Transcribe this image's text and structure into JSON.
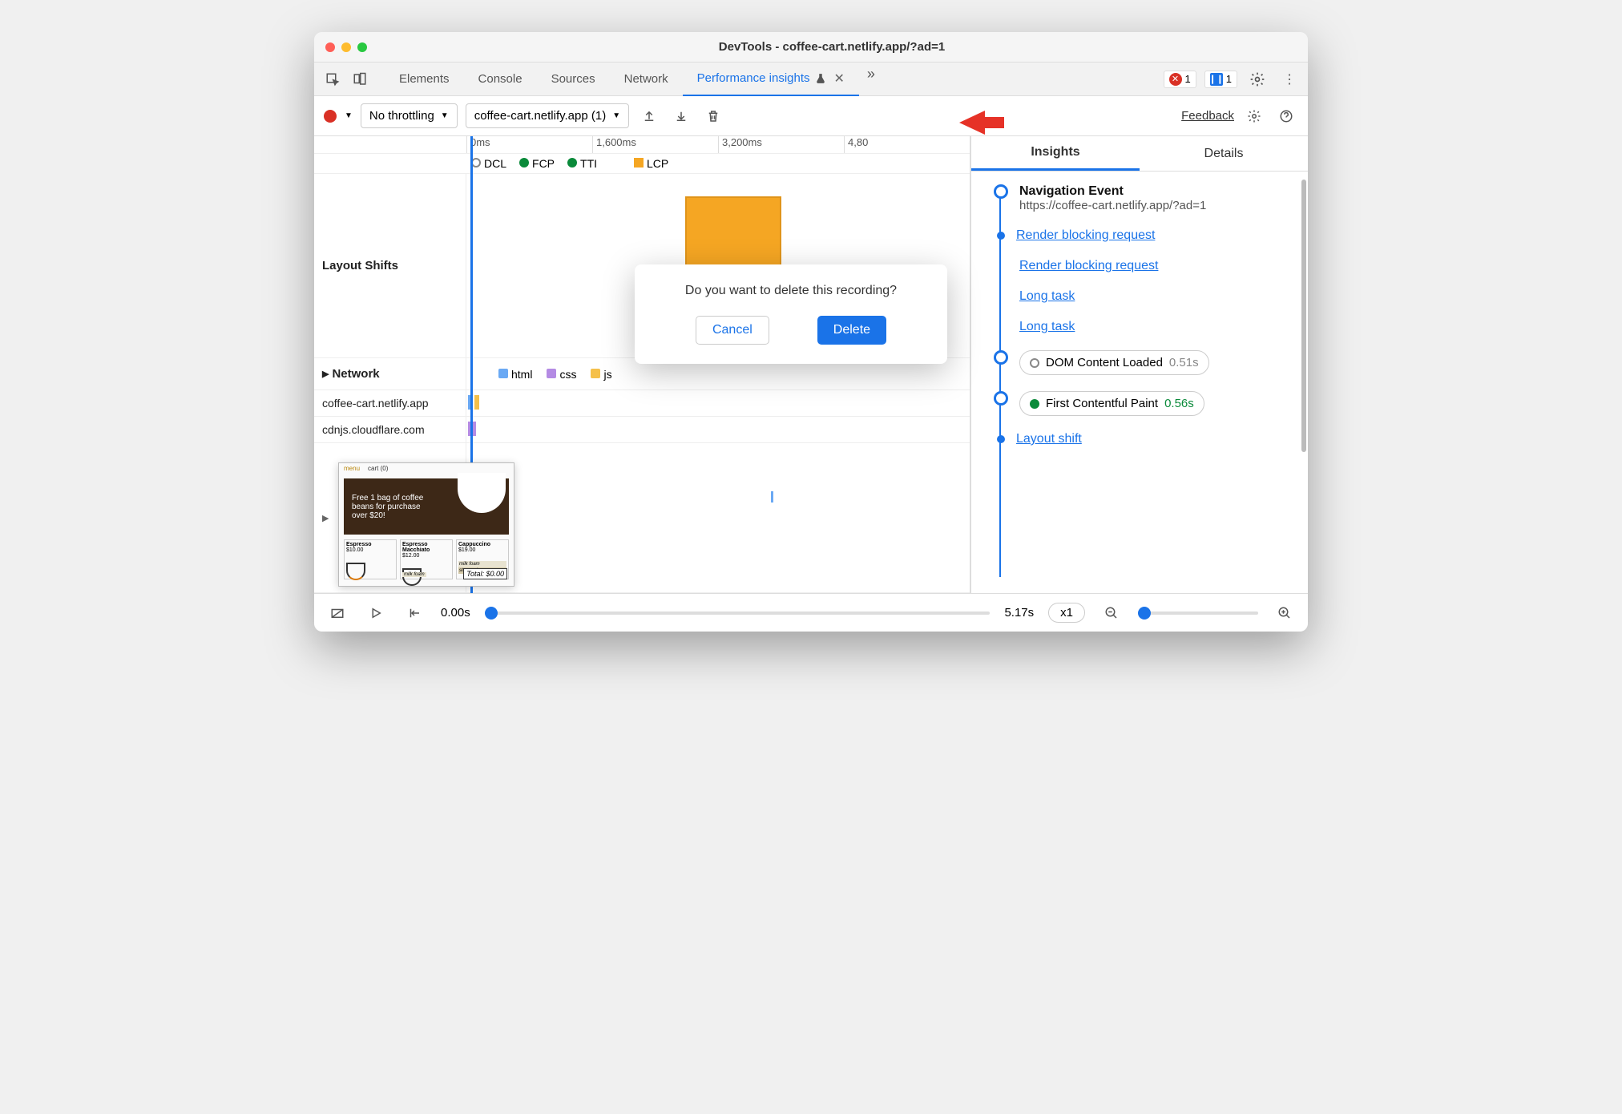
{
  "window": {
    "title": "DevTools - coffee-cart.netlify.app/?ad=1"
  },
  "tabs": {
    "items": [
      "Elements",
      "Console",
      "Sources",
      "Network",
      "Performance insights"
    ],
    "active": "Performance insights"
  },
  "badges": {
    "error_count": "1",
    "info_count": "1"
  },
  "toolbar": {
    "throttling": "No throttling",
    "recording": "coffee-cart.netlify.app (1)",
    "feedback": "Feedback"
  },
  "ruler": {
    "ticks": [
      "0ms",
      "1,600ms",
      "3,200ms",
      "4,80"
    ]
  },
  "legend": {
    "dcl": "DCL",
    "fcp": "FCP",
    "tti": "TTI",
    "lcp": "LCP"
  },
  "tracks": {
    "layout_shifts": "Layout Shifts",
    "network": "Network",
    "host1": "coffee-cart.netlify.app",
    "host2": "cdnjs.cloudflare.com"
  },
  "net_legend": {
    "html": "html",
    "css": "css",
    "js": "js"
  },
  "thumb": {
    "banner": "Free 1 bag of coffee beans for purchase over $20!",
    "total": "Total: $0.00",
    "prod1": "Espresso",
    "prod1_price": "$10.00",
    "prod2": "Espresso Macchiato",
    "prod2_price": "$12.00",
    "prod3": "Cappuccino",
    "prod3_price": "$19.00",
    "milk_foam": "milk foam",
    "steamed": "steamed",
    "menu": "menu",
    "cart": "cart (0)"
  },
  "dialog": {
    "text": "Do you want to delete this recording?",
    "cancel": "Cancel",
    "delete": "Delete"
  },
  "sidebar": {
    "tab_insights": "Insights",
    "tab_details": "Details",
    "nav_event": "Navigation Event",
    "nav_url": "https://coffee-cart.netlify.app/?ad=1",
    "rbr": "Render blocking request",
    "long_task": "Long task",
    "dcl_label": "DOM Content Loaded",
    "dcl_time": "0.51s",
    "fcp_label": "First Contentful Paint",
    "fcp_time": "0.56s",
    "layout_shift": "Layout shift"
  },
  "player": {
    "start": "0.00s",
    "end": "5.17s",
    "speed": "x1"
  }
}
